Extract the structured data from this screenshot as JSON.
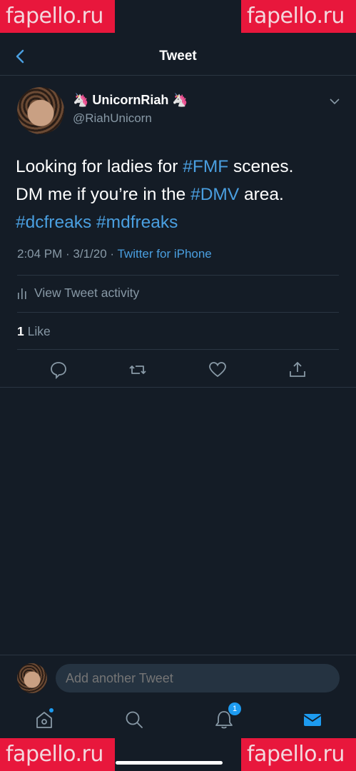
{
  "watermark": {
    "text": "fapello.ru"
  },
  "header": {
    "title": "Tweet"
  },
  "tweet": {
    "display_name": "🦄 UnicornRiah 🦄",
    "handle": "@RiahUnicorn",
    "text_parts": [
      {
        "text": "Looking for ladies for ",
        "tag": false
      },
      {
        "text": "#FMF",
        "tag": true
      },
      {
        "text": " scenes.\nDM me if you’re in the ",
        "tag": false
      },
      {
        "text": "#DMV",
        "tag": true
      },
      {
        "text": " area.\n",
        "tag": false
      },
      {
        "text": "#dcfreaks",
        "tag": true
      },
      {
        "text": " ",
        "tag": false
      },
      {
        "text": "#mdfreaks",
        "tag": true
      }
    ],
    "timestamp": "2:04 PM · 3/1/20 · ",
    "source": "Twitter for iPhone",
    "activity_label": "View Tweet activity",
    "like_count": "1",
    "like_label": " Like"
  },
  "reply": {
    "placeholder": "Add another Tweet"
  },
  "tabbar": {
    "notification_count": "1"
  },
  "icons": [
    "back-arrow-icon",
    "chevron-down-icon",
    "reply-icon",
    "retweet-icon",
    "like-icon",
    "share-icon",
    "bar-chart-icon",
    "home-icon",
    "search-icon",
    "bell-icon",
    "mail-icon"
  ],
  "colors": {
    "background": "#141c26",
    "accent": "#4a9fe0",
    "muted": "#8899a6"
  }
}
